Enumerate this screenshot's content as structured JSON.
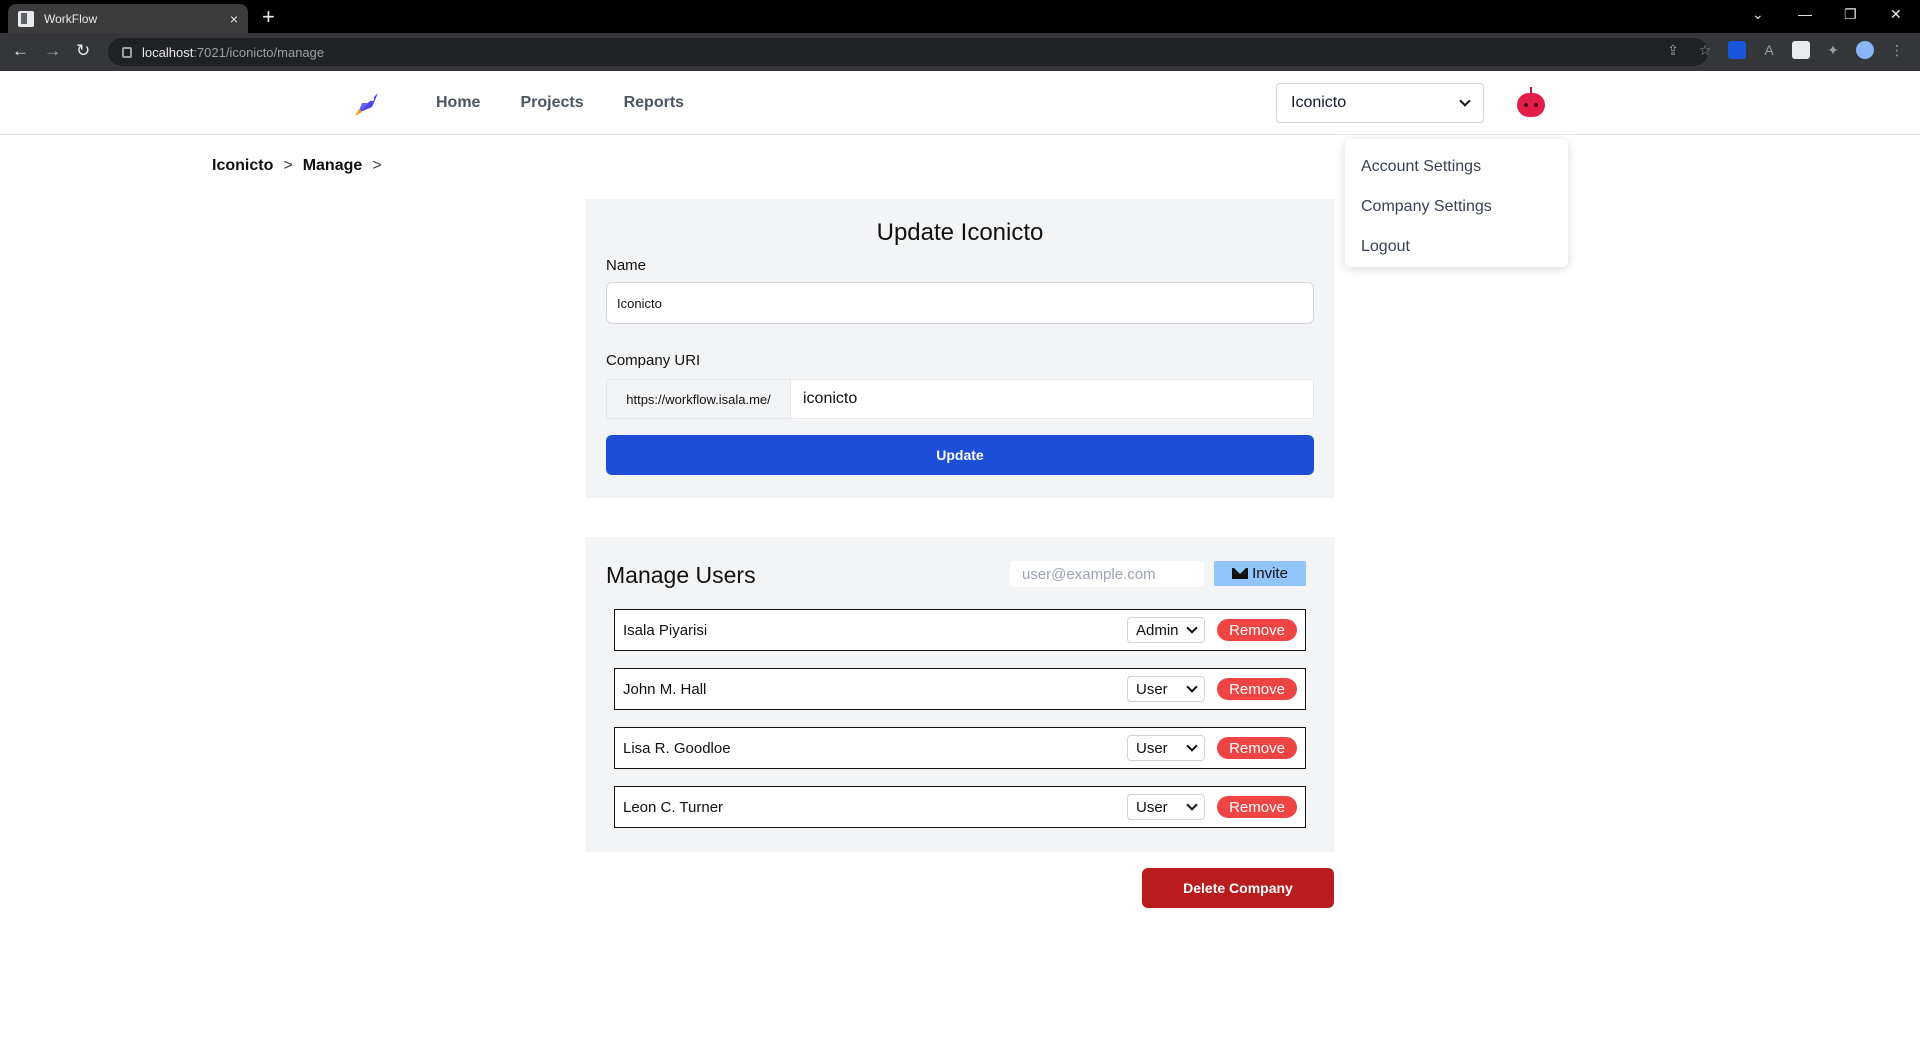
{
  "browser": {
    "tab_title": "WorkFlow",
    "tab_close": "×",
    "new_tab": "+",
    "url_host": "localhost",
    "url_path": ":7021/iconicto/manage"
  },
  "nav": {
    "links": [
      "Home",
      "Projects",
      "Reports"
    ],
    "company_select": "Iconicto"
  },
  "user_menu": {
    "items": [
      "Account Settings",
      "Company Settings",
      "Logout"
    ]
  },
  "breadcrumb": {
    "items": [
      "Iconicto",
      "Manage"
    ],
    "separator": ">"
  },
  "update_form": {
    "heading": "Update Iconicto",
    "name_label": "Name",
    "name_value": "Iconicto",
    "uri_label": "Company URI",
    "uri_prefix": "https://workflow.isala.me/",
    "uri_value": "iconicto",
    "update_button": "Update",
    "button_color": "#1d4ed8"
  },
  "manage_users": {
    "heading": "Manage Users",
    "invite_placeholder": "user@example.com",
    "invite_button": "Invite",
    "users": [
      {
        "name": "Isala Piyarisi",
        "role": "Admin",
        "remove": "Remove"
      },
      {
        "name": "John M. Hall",
        "role": "User",
        "remove": "Remove"
      },
      {
        "name": "Lisa R. Goodloe",
        "role": "User",
        "remove": "Remove"
      },
      {
        "name": "Leon C. Turner",
        "role": "User",
        "remove": "Remove"
      }
    ]
  },
  "delete_company": "Delete Company",
  "colors": {
    "remove": "#ef4444",
    "delete": "#b91c1c",
    "invite": "#93c5fd"
  }
}
